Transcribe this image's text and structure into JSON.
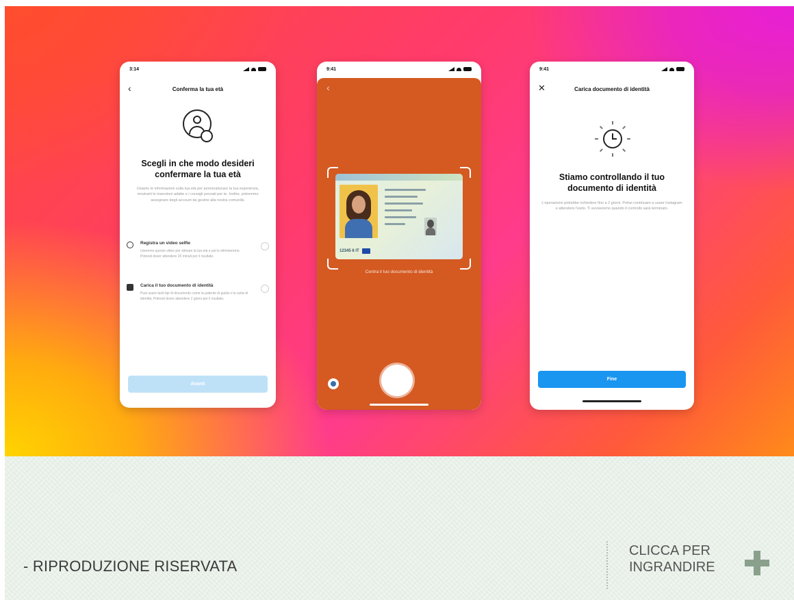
{
  "phones": {
    "p1": {
      "time": "3:14",
      "nav_title": "Conferma la tua età",
      "heading": "Scegli in che modo desideri confermare la tua età",
      "body": "Usiamo le informazioni sulla tua età per personalizzare la tua esperienza, mostrarti le inserzioni adatte e i consigli pensati per te. Inoltre, potremmo assegnare degli account da gestire alla nostra comunità.",
      "options": [
        {
          "title": "Registra un video selfie",
          "desc": "Useremo questo video per stimare la tua età e poi lo elimineremo. Potresti dover attendere 20 minuti per il risultato."
        },
        {
          "title": "Carica il tuo documento di identità",
          "desc": "Puoi usare tanti tipi di documento come la patente di guida o la carta di identità. Potresti dover attendere 2 giorni per il risultato."
        }
      ],
      "button": "Avanti"
    },
    "p2": {
      "time": "9:41",
      "caption": "Centra il tuo documento di identità",
      "card_code": "12345 6 IT"
    },
    "p3": {
      "time": "9:41",
      "nav_title": "Carica documento di identità",
      "heading": "Stiamo controllando il tuo documento di identità",
      "body": "L'operazione potrebbe richiedere fino a 2 giorni. Potrai continuare a usare Instagram e attendere l'esito. Ti avviseremo quando il controllo sarà terminato.",
      "button": "Fine"
    }
  },
  "footer": {
    "copyright": "- RIPRODUZIONE RISERVATA",
    "enlarge_line1": "CLICCA PER",
    "enlarge_line2": "INGRANDIRE"
  },
  "colors": {
    "accent": "#1a95f0",
    "camera_bg": "#d45a22",
    "plus": "#8aa08d"
  },
  "icons": [
    "chevron-left-icon",
    "user-badge-icon",
    "close-icon",
    "clock-icon",
    "camera-shutter-icon",
    "gallery-icon",
    "plus-icon"
  ]
}
